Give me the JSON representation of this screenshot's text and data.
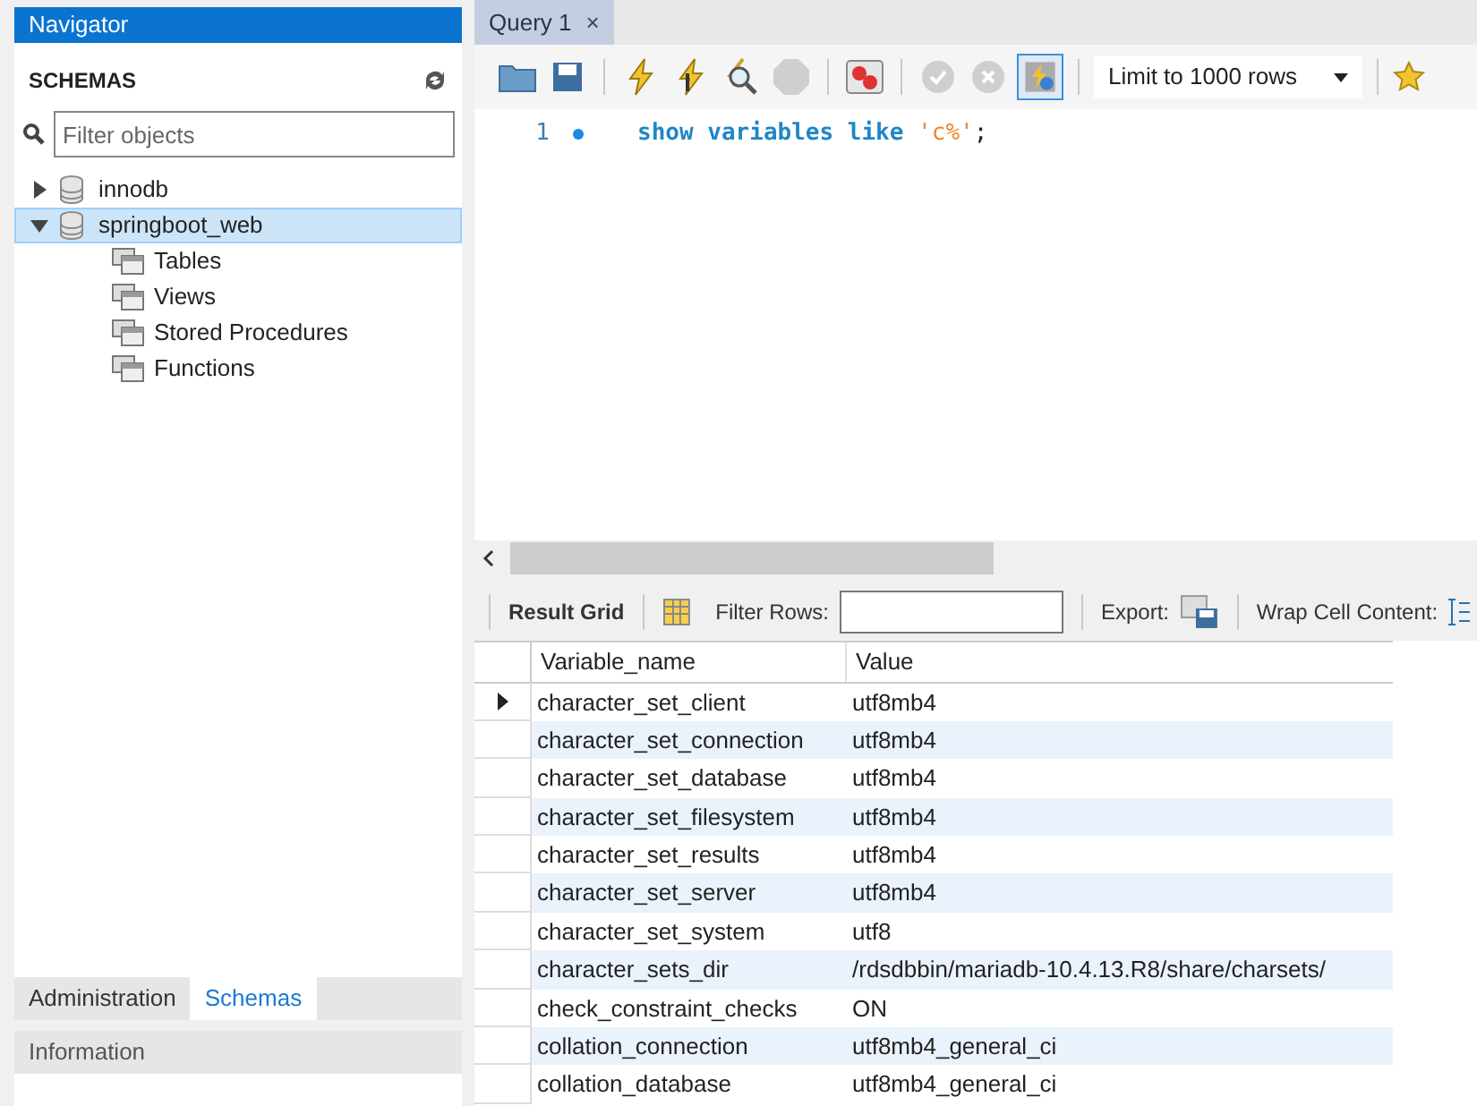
{
  "navigator": {
    "title": "Navigator",
    "section": "SCHEMAS",
    "filter": {
      "placeholder": "Filter objects"
    },
    "tree": [
      {
        "label": "innodb",
        "expanded": false,
        "selected": false
      },
      {
        "label": "springboot_web",
        "expanded": true,
        "selected": true,
        "children": [
          {
            "label": "Tables"
          },
          {
            "label": "Views"
          },
          {
            "label": "Stored Procedures"
          },
          {
            "label": "Functions"
          }
        ]
      }
    ],
    "tabs": [
      {
        "label": "Administration",
        "selected": false
      },
      {
        "label": "Schemas",
        "selected": true
      }
    ],
    "info_title": "Information"
  },
  "editor_tab": {
    "label": "Query 1",
    "close": "×"
  },
  "toolbar": {
    "limit": "Limit to 1000 rows",
    "autocommit_on": true
  },
  "editor": {
    "lines": [
      {
        "number": "1",
        "keyword": "show variables like ",
        "string": "'c%'",
        "end": ";"
      }
    ]
  },
  "result_toolbar": {
    "result_grid": "Result Grid",
    "filter_label": "Filter Rows:",
    "export_label": "Export:",
    "wrap_label": "Wrap Cell Content:"
  },
  "table": {
    "columns": [
      "Variable_name",
      "Value"
    ],
    "rows": [
      {
        "cells": [
          "character_set_client",
          "utf8mb4"
        ],
        "selected": true
      },
      {
        "cells": [
          "character_set_connection",
          "utf8mb4"
        ],
        "selected": false
      },
      {
        "cells": [
          "character_set_database",
          "utf8mb4"
        ],
        "selected": false
      },
      {
        "cells": [
          "character_set_filesystem",
          "utf8mb4"
        ],
        "selected": false
      },
      {
        "cells": [
          "character_set_results",
          "utf8mb4"
        ],
        "selected": false
      },
      {
        "cells": [
          "character_set_server",
          "utf8mb4"
        ],
        "selected": false
      },
      {
        "cells": [
          "character_set_system",
          "utf8"
        ],
        "selected": false
      },
      {
        "cells": [
          "character_sets_dir",
          "/rdsdbbin/mariadb-10.4.13.R8/share/charsets/"
        ],
        "selected": false
      },
      {
        "cells": [
          "check_constraint_checks",
          "ON"
        ],
        "selected": false
      },
      {
        "cells": [
          "collation_connection",
          "utf8mb4_general_ci"
        ],
        "selected": false
      },
      {
        "cells": [
          "collation_database",
          "utf8mb4_general_ci"
        ],
        "selected": false
      }
    ]
  }
}
